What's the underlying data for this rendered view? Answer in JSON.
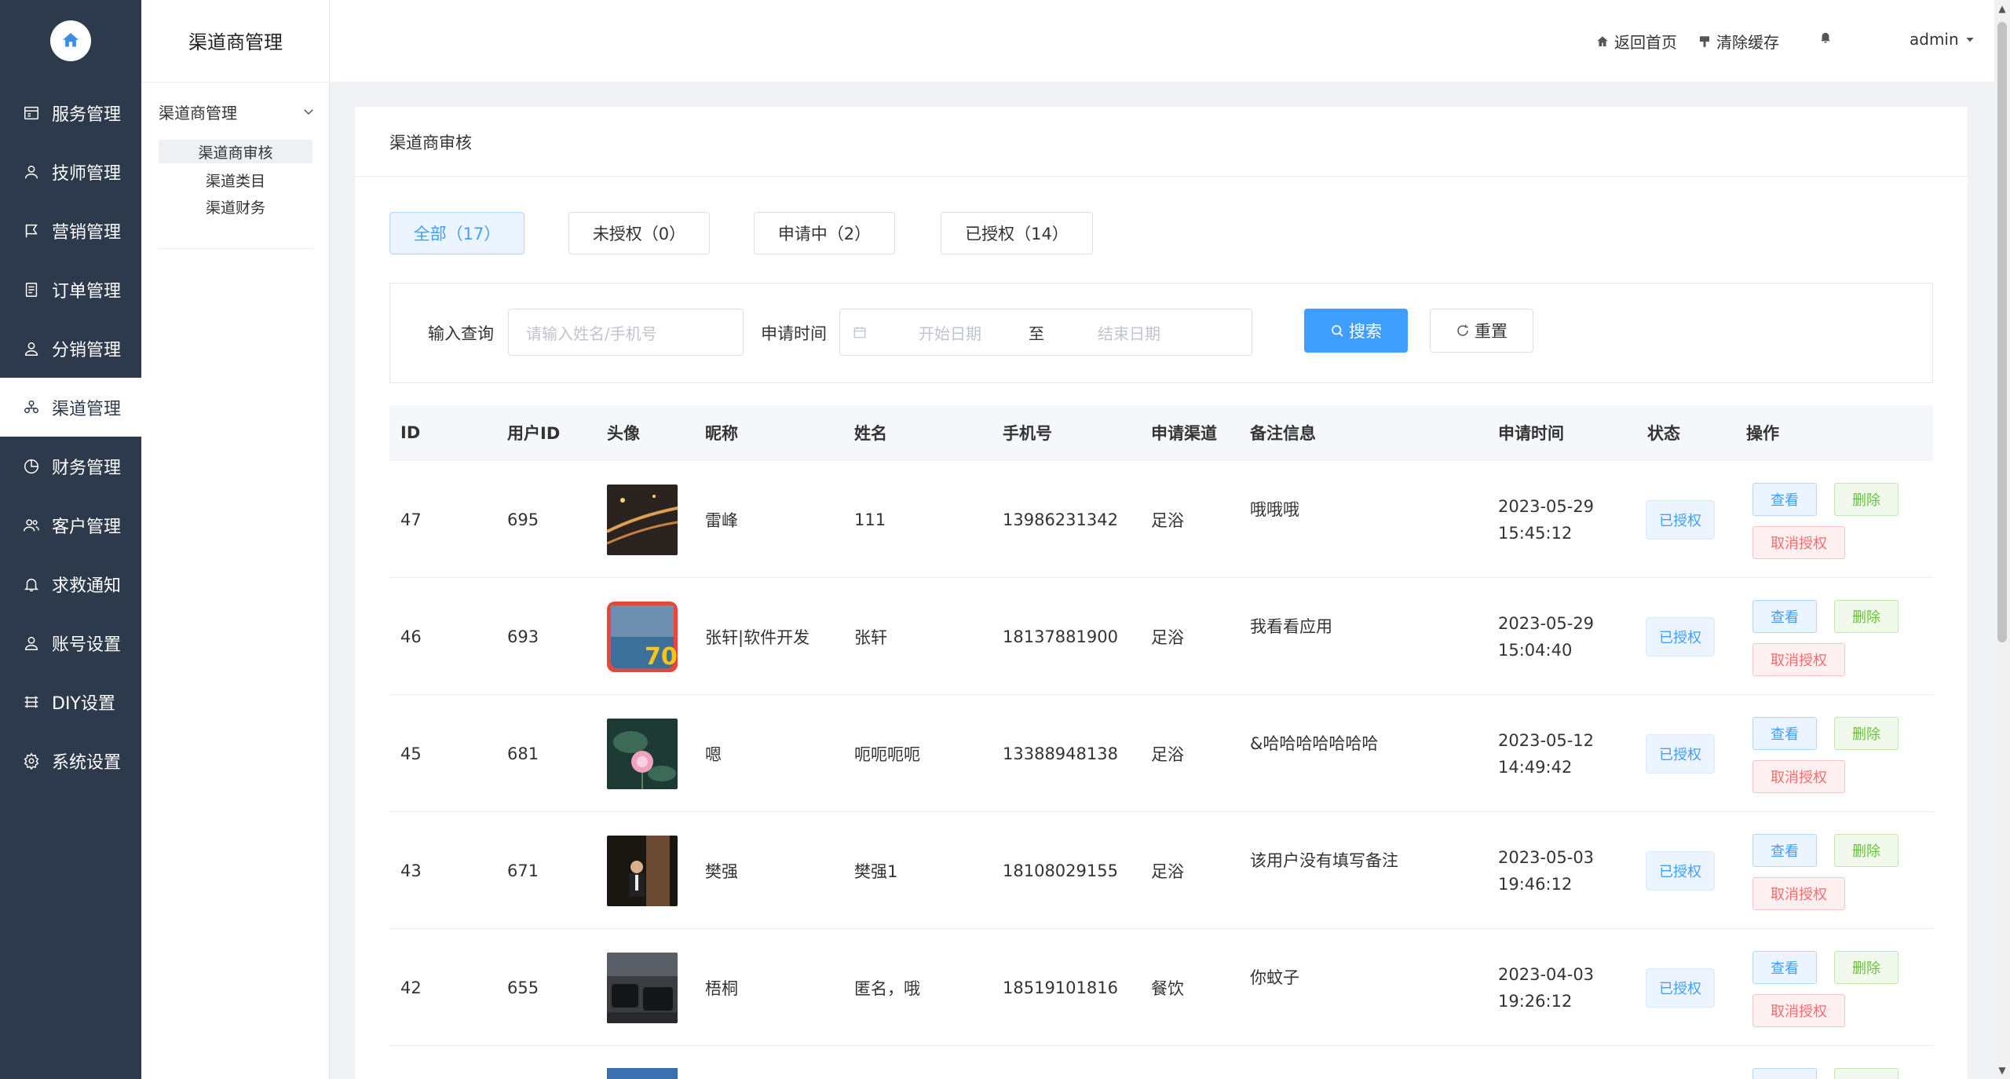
{
  "nav": {
    "items": [
      {
        "label": "服务管理",
        "icon": "service-icon"
      },
      {
        "label": "技师管理",
        "icon": "user-icon"
      },
      {
        "label": "营销管理",
        "icon": "marketing-icon"
      },
      {
        "label": "订单管理",
        "icon": "order-icon"
      },
      {
        "label": "分销管理",
        "icon": "distribution-icon"
      },
      {
        "label": "渠道管理",
        "icon": "channel-icon",
        "active": true
      },
      {
        "label": "财务管理",
        "icon": "finance-icon"
      },
      {
        "label": "客户管理",
        "icon": "customer-icon"
      },
      {
        "label": "求救通知",
        "icon": "bell-icon"
      },
      {
        "label": "账号设置",
        "icon": "account-icon"
      },
      {
        "label": "DIY设置",
        "icon": "diy-icon"
      },
      {
        "label": "系统设置",
        "icon": "settings-icon"
      }
    ]
  },
  "submenu": {
    "title": "渠道商管理",
    "group": "渠道商管理",
    "items": [
      "渠道商审核",
      "渠道类目",
      "渠道财务"
    ]
  },
  "header": {
    "home": "返回首页",
    "clear_cache": "清除缓存",
    "user": "admin"
  },
  "page": {
    "title": "渠道商审核",
    "tabs": [
      "全部（17）",
      "未授权（0）",
      "申请中（2）",
      "已授权（14）"
    ],
    "filter": {
      "query_label": "输入查询",
      "query_placeholder": "请输入姓名/手机号",
      "time_label": "申请时间",
      "start_placeholder": "开始日期",
      "to": "至",
      "end_placeholder": "结束日期",
      "search": "搜索",
      "reset": "重置"
    }
  },
  "table": {
    "columns": [
      "ID",
      "用户ID",
      "头像",
      "昵称",
      "姓名",
      "手机号",
      "申请渠道",
      "备注信息",
      "申请时间",
      "状态",
      "操作"
    ],
    "rows": [
      {
        "id": "47",
        "uid": "695",
        "nick": "雷峰",
        "name": "111",
        "phone": "13986231342",
        "channel": "足浴",
        "remark": "哦哦哦",
        "date": "2023-05-29",
        "time": "15:45:12",
        "status": "已授权"
      },
      {
        "id": "46",
        "uid": "693",
        "nick": "张轩|软件开发",
        "name": "张轩",
        "phone": "18137881900",
        "channel": "足浴",
        "remark": "我看看应用",
        "date": "2023-05-29",
        "time": "15:04:40",
        "status": "已授权"
      },
      {
        "id": "45",
        "uid": "681",
        "nick": "嗯",
        "name": "呃呃呃呃",
        "phone": "13388948138",
        "channel": "足浴",
        "remark": "&哈哈哈哈哈哈哈",
        "date": "2023-05-12",
        "time": "14:49:42",
        "status": "已授权"
      },
      {
        "id": "43",
        "uid": "671",
        "nick": "樊强",
        "name": "樊强1",
        "phone": "18108029155",
        "channel": "足浴",
        "remark": "该用户没有填写备注",
        "date": "2023-05-03",
        "time": "19:46:12",
        "status": "已授权"
      },
      {
        "id": "42",
        "uid": "655",
        "nick": "梧桐",
        "name": "匿名，哦",
        "phone": "18519101816",
        "channel": "餐饮",
        "remark": "你蚊子",
        "date": "2023-04-03",
        "time": "19:26:12",
        "status": "已授权"
      }
    ],
    "actions": {
      "view": "查看",
      "delete": "删除",
      "revoke": "取消授权"
    }
  },
  "colors": {
    "nav_bg": "#2d3a4b",
    "primary": "#409eff",
    "success": "#67c23a",
    "danger": "#f56c6c"
  }
}
